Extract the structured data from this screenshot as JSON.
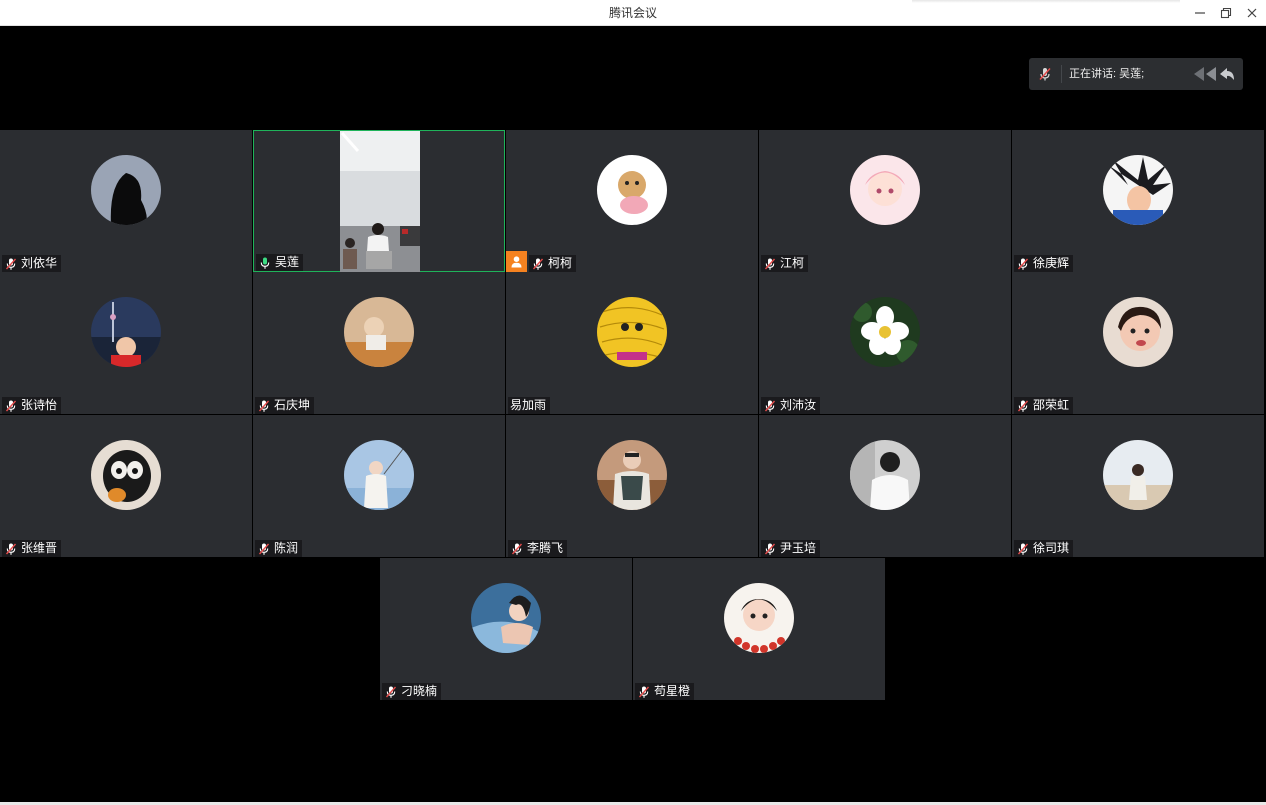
{
  "window": {
    "title": "腾讯会议",
    "minimize_icon": "minimize-icon",
    "restore_icon": "restore-icon",
    "close_icon": "close-icon"
  },
  "speaking_indicator": {
    "text": "正在讲话: 吴莲;",
    "icon": "mic-muted-icon"
  },
  "colors": {
    "tile_bg": "#2b2d31",
    "active_border": "#1fb35a",
    "host_badge": "#f58220",
    "muted_mic": "#e44b4b"
  },
  "participants": [
    {
      "name": "刘依华",
      "mic": "muted"
    },
    {
      "name": "吴莲",
      "mic": "active",
      "video": true
    },
    {
      "name": "柯柯",
      "mic": "muted",
      "host": true
    },
    {
      "name": "江柯",
      "mic": "muted"
    },
    {
      "name": "徐庚辉",
      "mic": "muted"
    },
    {
      "name": "张诗怡",
      "mic": "muted"
    },
    {
      "name": "石庆坤",
      "mic": "muted"
    },
    {
      "name": "易加雨",
      "mic": "none"
    },
    {
      "name": "刘沛汝",
      "mic": "muted"
    },
    {
      "name": "邵荣虹",
      "mic": "muted"
    },
    {
      "name": "张维晋",
      "mic": "muted"
    },
    {
      "name": "陈润",
      "mic": "muted"
    },
    {
      "name": "李腾飞",
      "mic": "muted"
    },
    {
      "name": "尹玉培",
      "mic": "muted"
    },
    {
      "name": "徐司琪",
      "mic": "muted"
    },
    {
      "name": "刁晓楠",
      "mic": "muted"
    },
    {
      "name": "苟星橙",
      "mic": "muted"
    }
  ]
}
